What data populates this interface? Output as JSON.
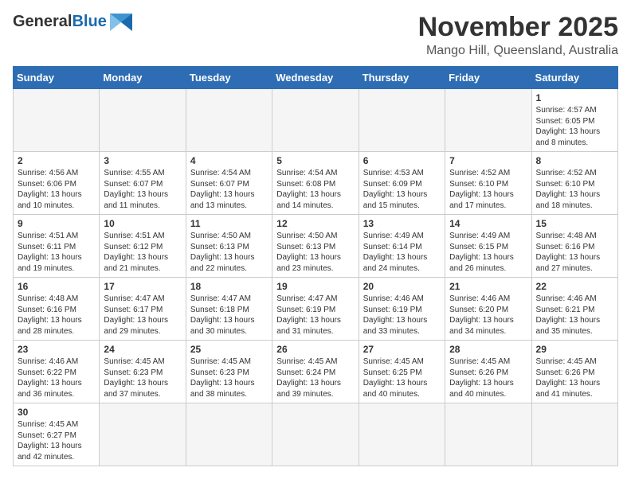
{
  "logo": {
    "general": "General",
    "blue": "Blue"
  },
  "header": {
    "month": "November 2025",
    "location": "Mango Hill, Queensland, Australia"
  },
  "weekdays": [
    "Sunday",
    "Monday",
    "Tuesday",
    "Wednesday",
    "Thursday",
    "Friday",
    "Saturday"
  ],
  "weeks": [
    [
      {
        "day": "",
        "info": ""
      },
      {
        "day": "",
        "info": ""
      },
      {
        "day": "",
        "info": ""
      },
      {
        "day": "",
        "info": ""
      },
      {
        "day": "",
        "info": ""
      },
      {
        "day": "",
        "info": ""
      },
      {
        "day": "1",
        "info": "Sunrise: 4:57 AM\nSunset: 6:05 PM\nDaylight: 13 hours\nand 8 minutes."
      }
    ],
    [
      {
        "day": "2",
        "info": "Sunrise: 4:56 AM\nSunset: 6:06 PM\nDaylight: 13 hours\nand 10 minutes."
      },
      {
        "day": "3",
        "info": "Sunrise: 4:55 AM\nSunset: 6:07 PM\nDaylight: 13 hours\nand 11 minutes."
      },
      {
        "day": "4",
        "info": "Sunrise: 4:54 AM\nSunset: 6:07 PM\nDaylight: 13 hours\nand 13 minutes."
      },
      {
        "day": "5",
        "info": "Sunrise: 4:54 AM\nSunset: 6:08 PM\nDaylight: 13 hours\nand 14 minutes."
      },
      {
        "day": "6",
        "info": "Sunrise: 4:53 AM\nSunset: 6:09 PM\nDaylight: 13 hours\nand 15 minutes."
      },
      {
        "day": "7",
        "info": "Sunrise: 4:52 AM\nSunset: 6:10 PM\nDaylight: 13 hours\nand 17 minutes."
      },
      {
        "day": "8",
        "info": "Sunrise: 4:52 AM\nSunset: 6:10 PM\nDaylight: 13 hours\nand 18 minutes."
      }
    ],
    [
      {
        "day": "9",
        "info": "Sunrise: 4:51 AM\nSunset: 6:11 PM\nDaylight: 13 hours\nand 19 minutes."
      },
      {
        "day": "10",
        "info": "Sunrise: 4:51 AM\nSunset: 6:12 PM\nDaylight: 13 hours\nand 21 minutes."
      },
      {
        "day": "11",
        "info": "Sunrise: 4:50 AM\nSunset: 6:13 PM\nDaylight: 13 hours\nand 22 minutes."
      },
      {
        "day": "12",
        "info": "Sunrise: 4:50 AM\nSunset: 6:13 PM\nDaylight: 13 hours\nand 23 minutes."
      },
      {
        "day": "13",
        "info": "Sunrise: 4:49 AM\nSunset: 6:14 PM\nDaylight: 13 hours\nand 24 minutes."
      },
      {
        "day": "14",
        "info": "Sunrise: 4:49 AM\nSunset: 6:15 PM\nDaylight: 13 hours\nand 26 minutes."
      },
      {
        "day": "15",
        "info": "Sunrise: 4:48 AM\nSunset: 6:16 PM\nDaylight: 13 hours\nand 27 minutes."
      }
    ],
    [
      {
        "day": "16",
        "info": "Sunrise: 4:48 AM\nSunset: 6:16 PM\nDaylight: 13 hours\nand 28 minutes."
      },
      {
        "day": "17",
        "info": "Sunrise: 4:47 AM\nSunset: 6:17 PM\nDaylight: 13 hours\nand 29 minutes."
      },
      {
        "day": "18",
        "info": "Sunrise: 4:47 AM\nSunset: 6:18 PM\nDaylight: 13 hours\nand 30 minutes."
      },
      {
        "day": "19",
        "info": "Sunrise: 4:47 AM\nSunset: 6:19 PM\nDaylight: 13 hours\nand 31 minutes."
      },
      {
        "day": "20",
        "info": "Sunrise: 4:46 AM\nSunset: 6:19 PM\nDaylight: 13 hours\nand 33 minutes."
      },
      {
        "day": "21",
        "info": "Sunrise: 4:46 AM\nSunset: 6:20 PM\nDaylight: 13 hours\nand 34 minutes."
      },
      {
        "day": "22",
        "info": "Sunrise: 4:46 AM\nSunset: 6:21 PM\nDaylight: 13 hours\nand 35 minutes."
      }
    ],
    [
      {
        "day": "23",
        "info": "Sunrise: 4:46 AM\nSunset: 6:22 PM\nDaylight: 13 hours\nand 36 minutes."
      },
      {
        "day": "24",
        "info": "Sunrise: 4:45 AM\nSunset: 6:23 PM\nDaylight: 13 hours\nand 37 minutes."
      },
      {
        "day": "25",
        "info": "Sunrise: 4:45 AM\nSunset: 6:23 PM\nDaylight: 13 hours\nand 38 minutes."
      },
      {
        "day": "26",
        "info": "Sunrise: 4:45 AM\nSunset: 6:24 PM\nDaylight: 13 hours\nand 39 minutes."
      },
      {
        "day": "27",
        "info": "Sunrise: 4:45 AM\nSunset: 6:25 PM\nDaylight: 13 hours\nand 40 minutes."
      },
      {
        "day": "28",
        "info": "Sunrise: 4:45 AM\nSunset: 6:26 PM\nDaylight: 13 hours\nand 40 minutes."
      },
      {
        "day": "29",
        "info": "Sunrise: 4:45 AM\nSunset: 6:26 PM\nDaylight: 13 hours\nand 41 minutes."
      }
    ],
    [
      {
        "day": "30",
        "info": "Sunrise: 4:45 AM\nSunset: 6:27 PM\nDaylight: 13 hours\nand 42 minutes."
      },
      {
        "day": "",
        "info": ""
      },
      {
        "day": "",
        "info": ""
      },
      {
        "day": "",
        "info": ""
      },
      {
        "day": "",
        "info": ""
      },
      {
        "day": "",
        "info": ""
      },
      {
        "day": "",
        "info": ""
      }
    ]
  ]
}
